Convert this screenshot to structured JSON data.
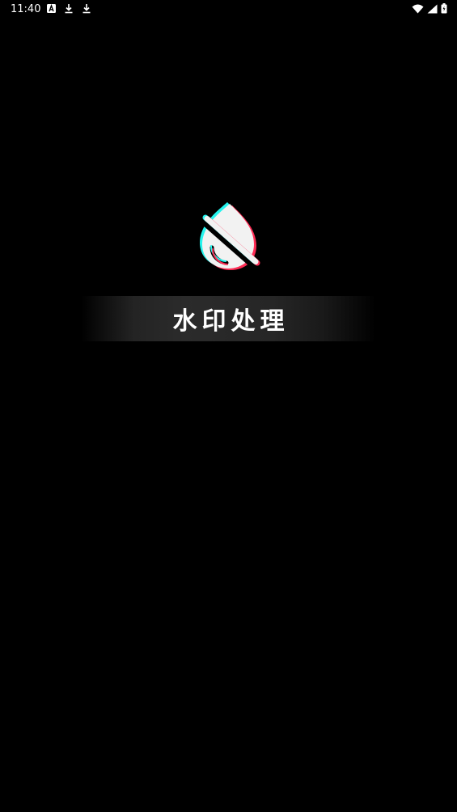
{
  "status_bar": {
    "time": "11:40",
    "left_icons": [
      "text-a-icon",
      "download-icon",
      "download-icon"
    ],
    "right_icons": [
      "wifi-icon",
      "cell-signal-icon",
      "battery-icon"
    ]
  },
  "splash": {
    "logo_icon": "no-drop-watermark-icon",
    "title": "水印处理"
  },
  "colors": {
    "background": "#000000",
    "logo_fill": "#f2f2f2",
    "logo_cyan": "#25f4ee",
    "logo_red": "#fe2c55",
    "title_text": "#ffffff"
  }
}
